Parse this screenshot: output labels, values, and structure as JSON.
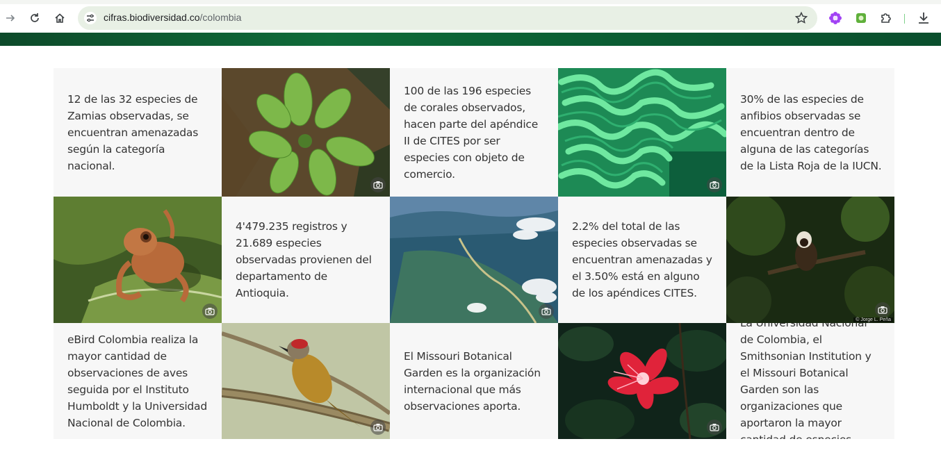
{
  "browser": {
    "url_host": "cifras.biodiversidad.co",
    "url_path": "/colombia",
    "icons": [
      "forward-icon",
      "reload-icon",
      "home-icon",
      "site-info-icon",
      "bookmark-star-icon",
      "extension-flower-icon",
      "extension-green-icon",
      "extensions-puzzle-icon",
      "download-icon"
    ]
  },
  "colors": {
    "banner": "#0f6b3a",
    "text_card_bg": "#f7f7f7",
    "text": "#333333"
  },
  "cards": [
    {
      "type": "text",
      "text": "12 de las 32 especies de Zamias observadas, se encuentran amenazadas según la categoría nacional."
    },
    {
      "type": "image",
      "subject": "zamia-plant"
    },
    {
      "type": "text",
      "text": "100 de las 196 especies de corales observados, hacen parte del apéndice II de CITES por ser especies con objeto de comercio."
    },
    {
      "type": "image",
      "subject": "brain-coral"
    },
    {
      "type": "text",
      "text": "30% de las especies de anfibios observadas se encuentran dentro de alguna de las categorías de la Lista Roja de la IUCN."
    },
    {
      "type": "image",
      "subject": "tree-frog"
    },
    {
      "type": "text",
      "text": "4'479.235 registros y 21.689 especies observadas provienen del departamento de Antioquia."
    },
    {
      "type": "image",
      "subject": "aerial-valley"
    },
    {
      "type": "text",
      "text": "2.2% del total de las especies observadas se encuentran amenazadas y el 3.50% está en alguno de los apéndices CITES."
    },
    {
      "type": "image",
      "subject": "tamarin-monkey",
      "credit": "© Jorge L. Peña"
    },
    {
      "type": "text",
      "text": "eBird Colombia realiza la mayor cantidad de observaciones de aves seguida por el Instituto Humboldt y la Universidad Nacional de Colombia."
    },
    {
      "type": "image",
      "subject": "woodpecker"
    },
    {
      "type": "text",
      "text": "El Missouri Botanical Garden es la organización internacional que más observaciones aporta."
    },
    {
      "type": "image",
      "subject": "red-passion-flower"
    },
    {
      "type": "text",
      "text": "La Universidad Nacional de Colombia, el Smithsonian Institution y el Missouri Botanical Garden son las organizaciones que aportaron la mayor cantidad de especies."
    }
  ]
}
